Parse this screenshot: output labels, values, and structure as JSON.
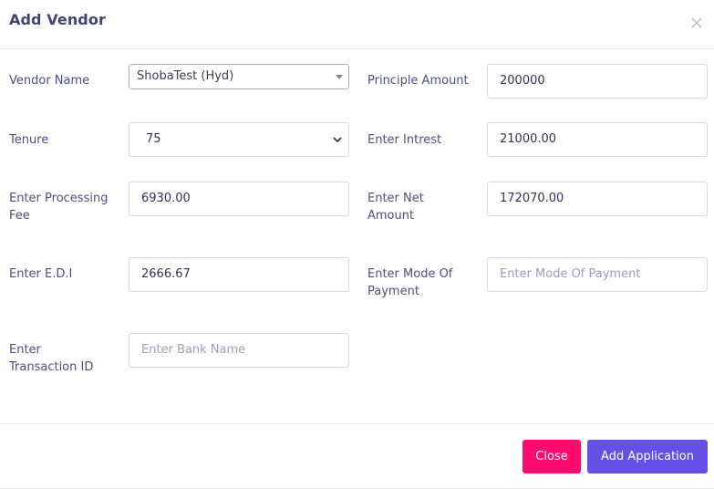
{
  "modal": {
    "title": "Add Vendor"
  },
  "form": {
    "vendor_name": {
      "label": "Vendor Name",
      "value": "ShobaTest (Hyd)"
    },
    "principle_amount": {
      "label": "Principle Amount",
      "value": "200000"
    },
    "tenure": {
      "label": "Tenure",
      "value": "75"
    },
    "interest": {
      "label": "Enter Intrest",
      "value": "21000.00"
    },
    "processing_fee": {
      "label_line1": "Enter Processing",
      "label_line2": "Fee",
      "value": "6930.00"
    },
    "net_amount": {
      "label_line1": "Enter Net",
      "label_line2": "Amount",
      "value": "172070.00"
    },
    "edi": {
      "label": "Enter E.D.I",
      "value": "2666.67"
    },
    "mode_of_payment": {
      "label_line1": "Enter Mode Of",
      "label_line2": "Payment",
      "placeholder": "Enter Mode Of Payment"
    },
    "transaction_id": {
      "label_line1": "Enter",
      "label_line2": "Transaction ID",
      "placeholder": "Enter Bank Name"
    }
  },
  "footer": {
    "close_label": "Close",
    "add_label": "Add Application"
  },
  "colors": {
    "close_button": "#fb0b6e",
    "add_button": "#6551e8",
    "label_text": "#4b5080"
  },
  "icons": {
    "close": "close-icon",
    "select_arrow": "caret-down-icon",
    "select_chevron": "chevron-down-icon"
  }
}
